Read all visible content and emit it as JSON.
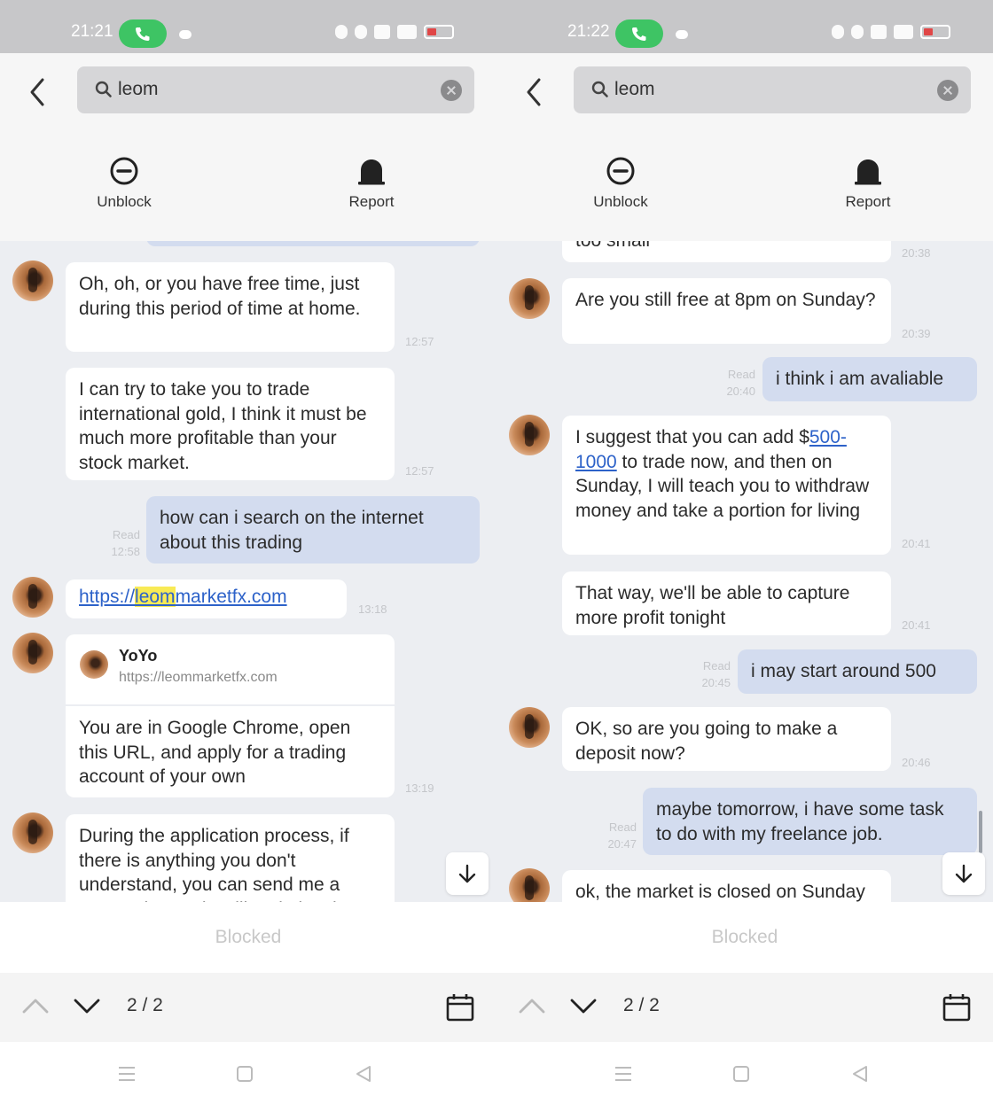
{
  "panels": [
    {
      "status_time": "21:21",
      "search": {
        "value": "leom"
      },
      "actions": {
        "unblock": "Unblock",
        "report": "Report"
      },
      "messages": {
        "m1": {
          "text": "Oh, oh, or you have free time, just during this period of time at home.",
          "time": "12:57"
        },
        "m2": {
          "text": "I can try to take you to trade international gold, I think it must be much more profitable than your stock market.",
          "time": "12:57"
        },
        "m3": {
          "text": "how can i search on the internet about this trading",
          "read": "Read",
          "time": "12:58"
        },
        "m4": {
          "link_pre": "https://",
          "link_hl": "leom",
          "link_post": "marketfx.com",
          "time": "13:18"
        },
        "m5": {
          "card_name": "YoYo",
          "card_url": "https://leommarketfx.com",
          "text": "You are in Google Chrome, open this URL, and apply for a trading account of your own",
          "time": "13:19"
        },
        "m6": {
          "text": "During the application process, if there is anything you don't understand, you can send me a screenshot and I will optimize the"
        }
      },
      "blocked": "Blocked",
      "nav_count": "2 / 2"
    },
    {
      "status_time": "21:22",
      "search": {
        "value": "leom"
      },
      "actions": {
        "unblock": "Unblock",
        "report": "Report"
      },
      "messages": {
        "m0": {
          "text": "too small",
          "time": "20:38"
        },
        "m1": {
          "text": "Are you still free at 8pm on Sunday?",
          "time": "20:39"
        },
        "m2": {
          "text": "i think i am avaliable",
          "read": "Read",
          "time": "20:40"
        },
        "m3": {
          "pre": "I suggest that you can add ",
          "dollar": "$",
          "amount": "500-1000",
          "post": " to trade now, and then on Sunday, I will teach you to withdraw money and take a portion for living",
          "time": "20:41"
        },
        "m4": {
          "text": "That way, we'll be able to capture more profit tonight",
          "time": "20:41"
        },
        "m5": {
          "text": "i may start around 500",
          "read": "Read",
          "time": "20:45"
        },
        "m6": {
          "text": "OK, so are you going to make a deposit now?",
          "time": "20:46"
        },
        "m7": {
          "text": "maybe tomorrow, i have some task to do with my freelance job.",
          "read": "Read",
          "time": "20:47"
        },
        "m8": {
          "text": "ok, the market is closed on Sunday"
        }
      },
      "blocked": "Blocked",
      "nav_count": "2 / 2"
    }
  ],
  "colors": {
    "incoming": "#ffffff",
    "outgoing": "#d3dcef",
    "chat_bg": "#eceef2",
    "link": "#2d62c9",
    "call_pill": "#3ec464"
  },
  "icons": [
    "back-arrow-icon",
    "search-icon",
    "clear-icon",
    "unblock-icon",
    "report-icon",
    "call-icon",
    "scroll-down-icon",
    "chevron-up-icon",
    "chevron-down-icon",
    "calendar-icon",
    "menu-icon",
    "home-icon",
    "back-triangle-icon"
  ]
}
